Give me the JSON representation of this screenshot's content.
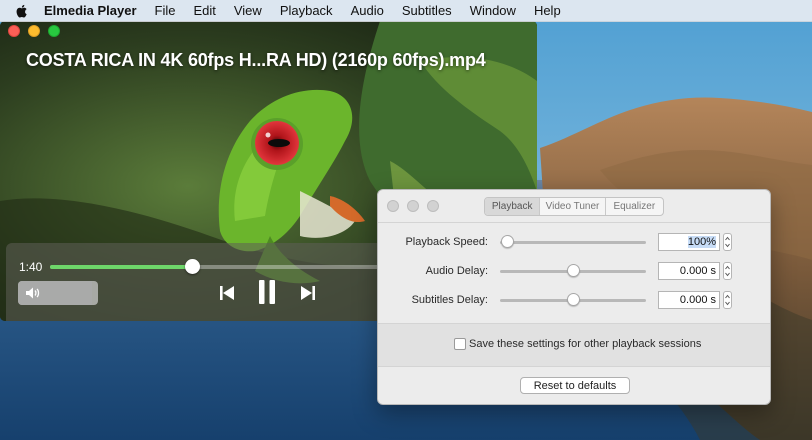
{
  "menubar": {
    "app": "Elmedia Player",
    "items": [
      "File",
      "Edit",
      "View",
      "Playback",
      "Audio",
      "Subtitles",
      "Window",
      "Help"
    ]
  },
  "player": {
    "title": "COSTA RICA IN 4K 60fps H...RA HD) (2160p 60fps).mp4",
    "elapsed": "1:40",
    "progress": 0.295,
    "volume": 0.92,
    "icons": [
      "volume-icon",
      "previous-icon",
      "pause-icon",
      "next-icon"
    ]
  },
  "settings": {
    "tabs": [
      "Playback",
      "Video Tuner",
      "Equalizer"
    ],
    "active_tab": "Playback",
    "rows": [
      {
        "label": "Playback Speed:",
        "value": "100%",
        "level": 0.05
      },
      {
        "label": "Audio Delay:",
        "value": "0.000 s",
        "level": 0.5
      },
      {
        "label": "Subtitles Delay:",
        "value": "0.000 s",
        "level": 0.5
      }
    ],
    "save_label": "Save these settings for other playback sessions",
    "reset_label": "Reset to defaults"
  },
  "colors": {
    "accent_progress": "#6ed66a",
    "close": "#fc5f57",
    "minimize": "#fdbc2e",
    "maximize": "#28c840"
  }
}
